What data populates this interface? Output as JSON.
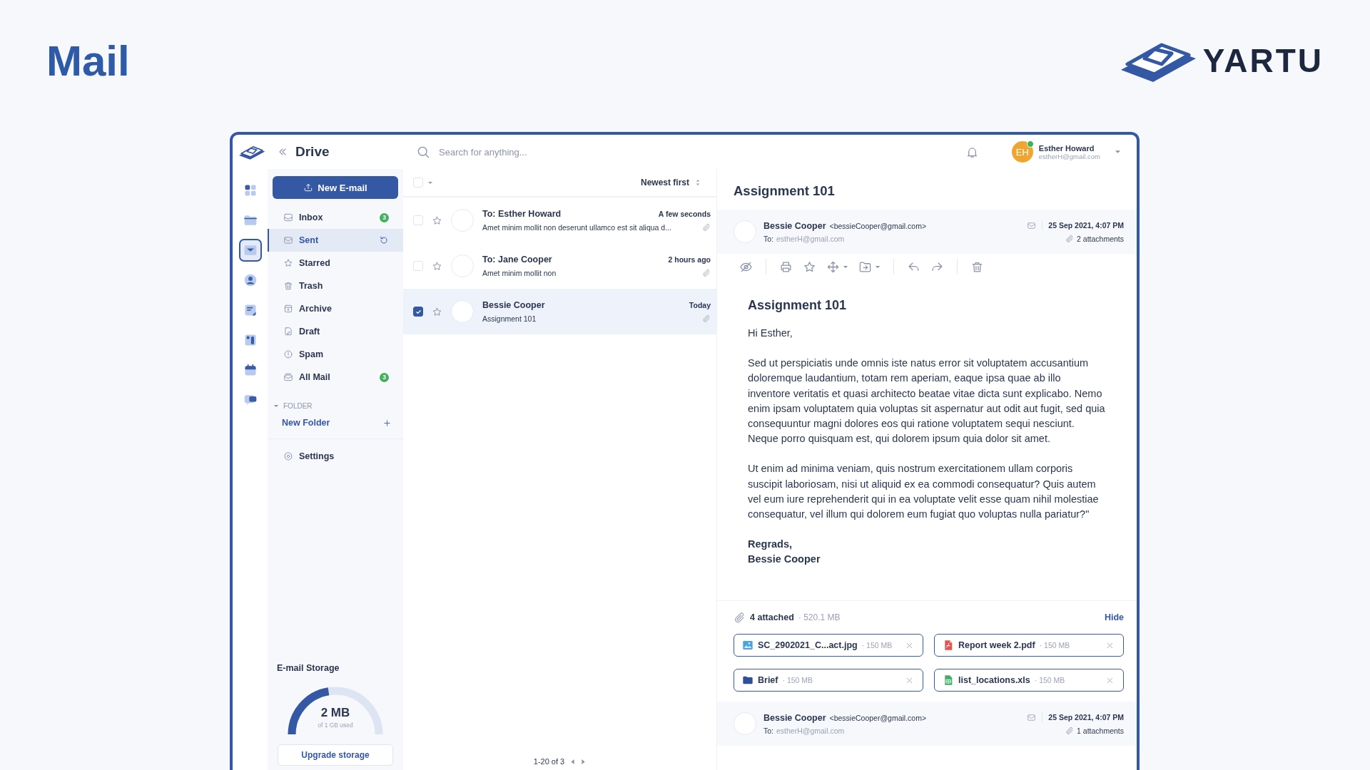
{
  "page_title": "Mail",
  "brand": {
    "name": "YARTU"
  },
  "app": {
    "title": "Drive"
  },
  "search": {
    "placeholder": "Search for anything..."
  },
  "user": {
    "initials": "EH",
    "name": "Esther Howard",
    "email": "estherH@gmail.com",
    "online": true
  },
  "rail": [
    {
      "kind": "apps",
      "selected": false
    },
    {
      "kind": "folder",
      "selected": false
    },
    {
      "kind": "mail",
      "selected": true
    },
    {
      "kind": "contact",
      "selected": false
    },
    {
      "kind": "note",
      "selected": false
    },
    {
      "kind": "board",
      "selected": false
    },
    {
      "kind": "calendar",
      "selected": false
    },
    {
      "kind": "chat",
      "selected": false
    }
  ],
  "compose_button": "New E-mail",
  "mailboxes": [
    {
      "kind": "inbox",
      "label": "Inbox",
      "badge": "3",
      "selected": false,
      "refresh": false
    },
    {
      "kind": "sent",
      "label": "Sent",
      "selected": true,
      "refresh": true
    },
    {
      "kind": "starred",
      "label": "Starred",
      "selected": false,
      "refresh": false
    },
    {
      "kind": "trash",
      "label": "Trash",
      "selected": false,
      "refresh": false
    },
    {
      "kind": "archive",
      "label": "Archive",
      "selected": false,
      "refresh": false
    },
    {
      "kind": "draft",
      "label": "Draft",
      "selected": false,
      "refresh": false
    },
    {
      "kind": "spam",
      "label": "Spam",
      "selected": false,
      "refresh": false
    },
    {
      "kind": "all",
      "label": "All Mail",
      "badge": "3",
      "selected": false,
      "refresh": false
    }
  ],
  "folders": {
    "heading": "FOLDER",
    "expanded": true,
    "new_folder": "New Folder"
  },
  "settings": "Settings",
  "storage": {
    "title": "E-mail Storage",
    "used": "2 MB",
    "of": "of 1 GB used",
    "level": 0.45,
    "button": "Upgrade storage"
  },
  "list": {
    "select_all": false,
    "sort": "Newest first",
    "messages": [
      {
        "title": "To: Esther Howard",
        "preview": "Amet minim mollit non deserunt ullamco est sit aliqua d...",
        "time": "A few seconds",
        "checked": false,
        "starred": false,
        "attachment": true,
        "selected": false
      },
      {
        "title": "To: Jane Cooper",
        "preview": "Amet minim mollit non",
        "time": "2 hours ago",
        "checked": false,
        "starred": false,
        "attachment": true,
        "selected": false
      },
      {
        "title": "Bessie Cooper",
        "preview": "Assignment 101",
        "time": "Today",
        "checked": true,
        "starred": false,
        "attachment": true,
        "selected": true
      }
    ],
    "pagination": "1-20 of 3"
  },
  "reader": {
    "subject": "Assignment 101",
    "headers": [
      {
        "sender": "Bessie Cooper",
        "address": "<bessieCooper@gmail.com>",
        "to_label": "To:",
        "to": "estherH@gmail.com",
        "date": "25 Sep 2021, 4:07 PM",
        "attachments": "2 attachments"
      },
      {
        "sender": "Bessie Cooper",
        "address": "<bessieCooper@gmail.com>",
        "to_label": "To:",
        "to": "estherH@gmail.com",
        "date": "25 Sep 2021, 4:07 PM",
        "attachments": "1 attachments"
      }
    ],
    "body": {
      "heading": "Assignment 101",
      "greeting": "Hi Esther,",
      "paragraphs": [
        "Sed ut perspiciatis unde omnis iste natus error sit voluptatem accusantium doloremque laudantium, totam rem aperiam, eaque ipsa quae ab illo inventore veritatis et quasi architecto beatae vitae dicta sunt explicabo. Nemo enim ipsam voluptatem quia voluptas sit aspernatur aut odit aut fugit, sed quia consequuntur magni dolores eos qui ratione voluptatem sequi nesciunt. Neque porro quisquam est, qui dolorem ipsum quia dolor sit amet.",
        "Ut enim ad minima veniam, quis nostrum exercitationem ullam corporis suscipit laboriosam, nisi ut aliquid ex ea commodi consequatur? Quis autem vel eum iure reprehenderit qui in ea voluptate velit esse quam nihil molestiae consequatur, vel illum qui dolorem eum fugiat quo voluptas nulla pariatur?\""
      ],
      "signoff": [
        "Regrads,",
        "Bessie Cooper"
      ]
    },
    "attached": {
      "count": "4 attached",
      "size": "· 520.1 MB",
      "hide": "Hide",
      "files": [
        {
          "kind": "image",
          "name": "SC_2902021_C...act.jpg",
          "size": "· 150 MB"
        },
        {
          "kind": "pdf",
          "name": "Report week 2.pdf",
          "size": "· 150 MB"
        },
        {
          "kind": "folder",
          "name": "Brief",
          "size": "· 150 MB"
        },
        {
          "kind": "sheet",
          "name": "list_locations.xls",
          "size": "· 150 MB"
        }
      ]
    }
  }
}
